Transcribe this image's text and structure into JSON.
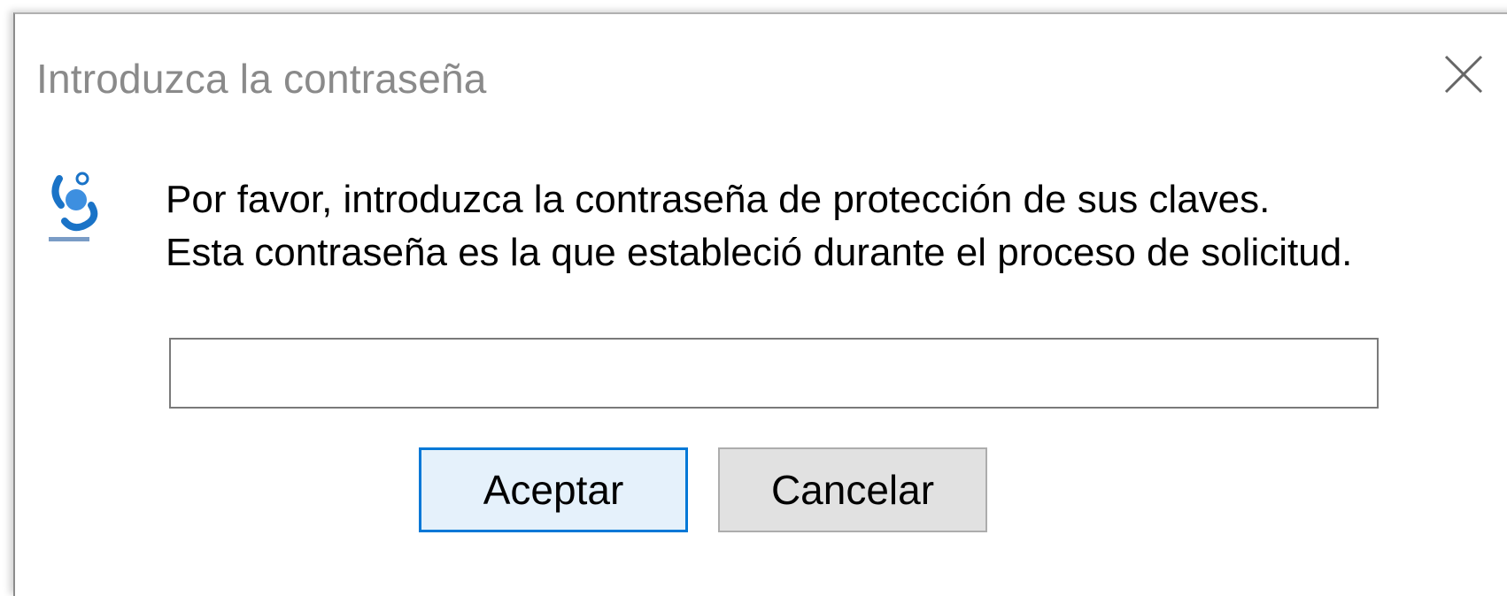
{
  "dialog": {
    "title": "Introduzca la contraseña",
    "close_icon": "close-icon",
    "app_icon": "certificate-app-icon",
    "message_line1": "Por favor, introduzca la contraseña de protección de sus claves.",
    "message_line2": "Esta contraseña es la que estableció durante el proceso de solicitud.",
    "password_value": "",
    "ok_label": "Aceptar",
    "cancel_label": "Cancelar"
  },
  "colors": {
    "ok_border": "#0078d7",
    "ok_background": "#e5f1fb",
    "cancel_background": "#e1e1e1",
    "title_text": "#8a8a8a",
    "icon_blue": "#1a73c7"
  }
}
